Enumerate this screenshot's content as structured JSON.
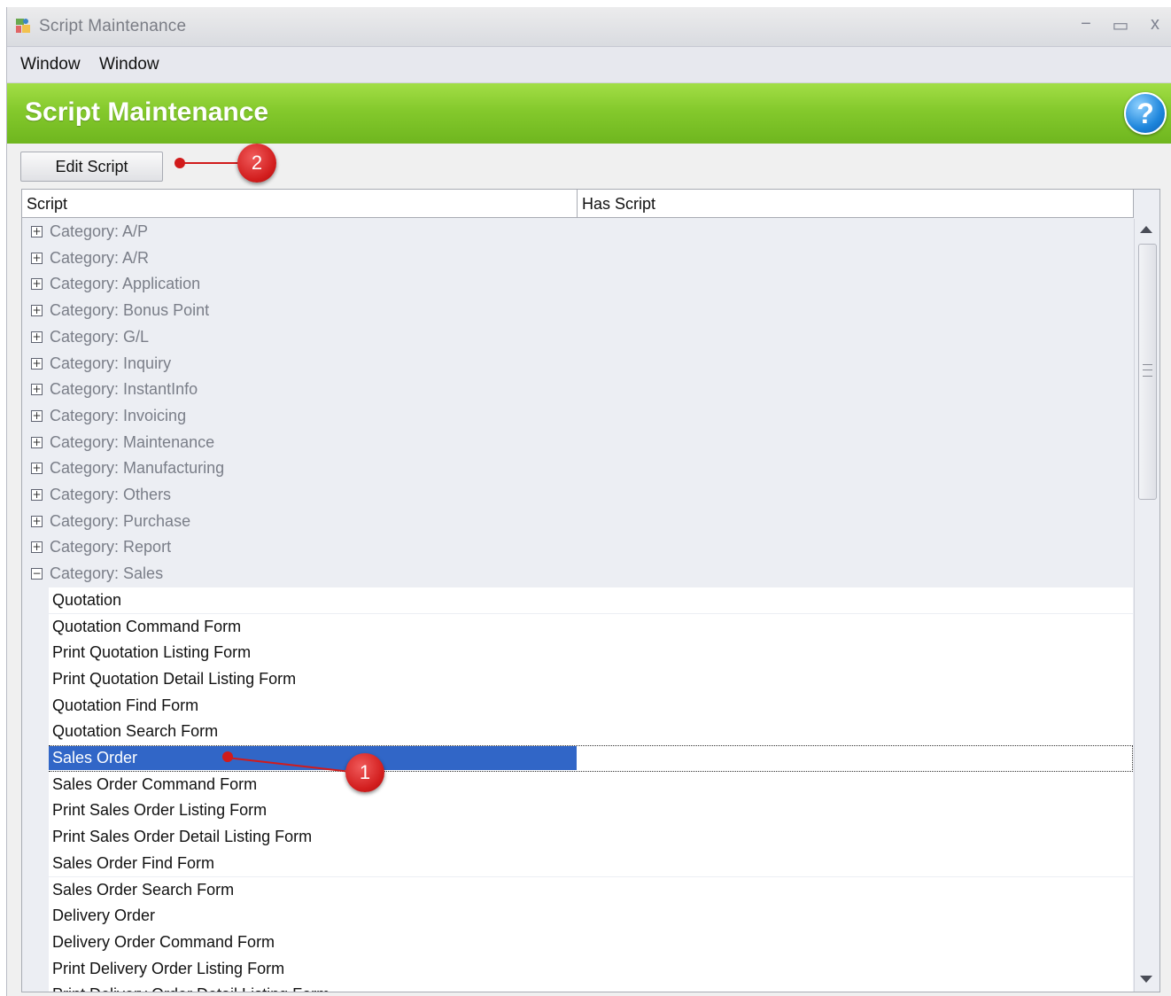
{
  "window": {
    "title": "Script Maintenance",
    "controls": {
      "minimize": "−",
      "maximize": "▭",
      "close": "x"
    }
  },
  "menu": [
    "Window",
    "Window"
  ],
  "header": {
    "title": "Script Maintenance",
    "help_label": "?"
  },
  "toolbar": {
    "edit_script_label": "Edit Script"
  },
  "grid": {
    "columns": [
      "Script",
      "Has Script"
    ],
    "categories": [
      "Category: A/P",
      "Category: A/R",
      "Category: Application",
      "Category: Bonus Point",
      "Category: G/L",
      "Category: Inquiry",
      "Category: InstantInfo",
      "Category: Invoicing",
      "Category: Maintenance",
      "Category: Manufacturing",
      "Category: Others",
      "Category: Purchase",
      "Category: Report",
      "Category: Sales"
    ],
    "expanded_category": "Category: Sales",
    "sales_items": [
      "Quotation",
      "Quotation Command Form",
      "Print Quotation Listing Form",
      "Print Quotation Detail Listing Form",
      "Quotation Find Form",
      "Quotation Search Form",
      "Sales Order",
      "Sales Order Command Form",
      "Print Sales Order Listing Form",
      "Print Sales Order Detail Listing Form",
      "Sales Order Find Form",
      "Sales Order Search Form",
      "Delivery Order",
      "Delivery Order Command Form",
      "Print Delivery Order Listing Form",
      "Print Delivery Order Detail Listing Form"
    ],
    "selected_item": "Sales Order"
  },
  "annotations": [
    {
      "number": "1",
      "target": "Sales Order"
    },
    {
      "number": "2",
      "target": "Edit Script"
    }
  ],
  "colors": {
    "header_green": "#84c92c",
    "selection_blue": "#3166c7",
    "annotation_red": "#d21d1d"
  }
}
